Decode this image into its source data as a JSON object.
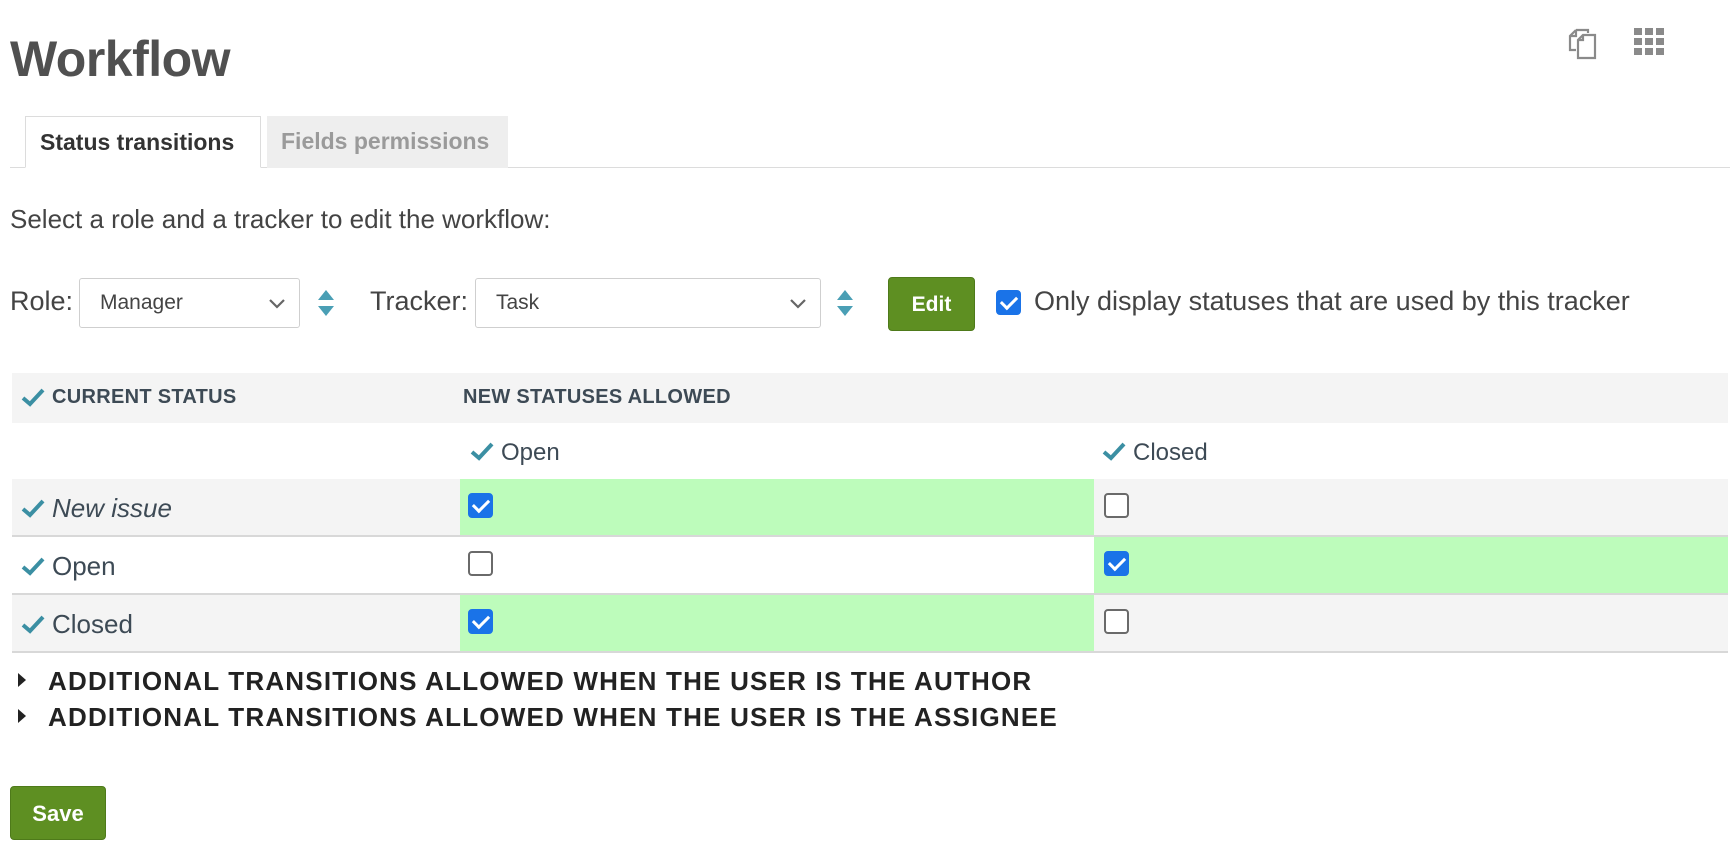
{
  "header": {
    "title": "Workflow",
    "icons": [
      "copy-icon",
      "apps-grid-icon"
    ]
  },
  "tabs": [
    {
      "label": "Status transitions",
      "active": true
    },
    {
      "label": "Fields permissions",
      "active": false
    }
  ],
  "instruction": "Select a role and a tracker to edit the workflow:",
  "filters": {
    "role_label": "Role:",
    "role_value": "Manager",
    "tracker_label": "Tracker:",
    "tracker_value": "Task",
    "edit_label": "Edit",
    "only_used_checked": true,
    "only_used_label": "Only display statuses that are used by this tracker"
  },
  "table": {
    "current_status_header": "CURRENT STATUS",
    "new_statuses_header": "NEW STATUSES ALLOWED",
    "columns": [
      "Open",
      "Closed"
    ],
    "rows": [
      {
        "name": "New issue",
        "italic": true,
        "checks": [
          true,
          false
        ]
      },
      {
        "name": "Open",
        "italic": false,
        "checks": [
          false,
          true
        ]
      },
      {
        "name": "Closed",
        "italic": false,
        "checks": [
          true,
          false
        ]
      }
    ]
  },
  "sections": {
    "author": "ADDITIONAL TRANSITIONS ALLOWED WHEN THE USER IS THE AUTHOR",
    "assignee": "ADDITIONAL TRANSITIONS ALLOWED WHEN THE USER IS THE ASSIGNEE"
  },
  "save_label": "Save",
  "colors": {
    "button_green": "#5e8f22",
    "allowed_cell": "#bdfcbb",
    "checkbox_blue": "#1a73e8",
    "tick_teal": "#3b8fa3"
  }
}
